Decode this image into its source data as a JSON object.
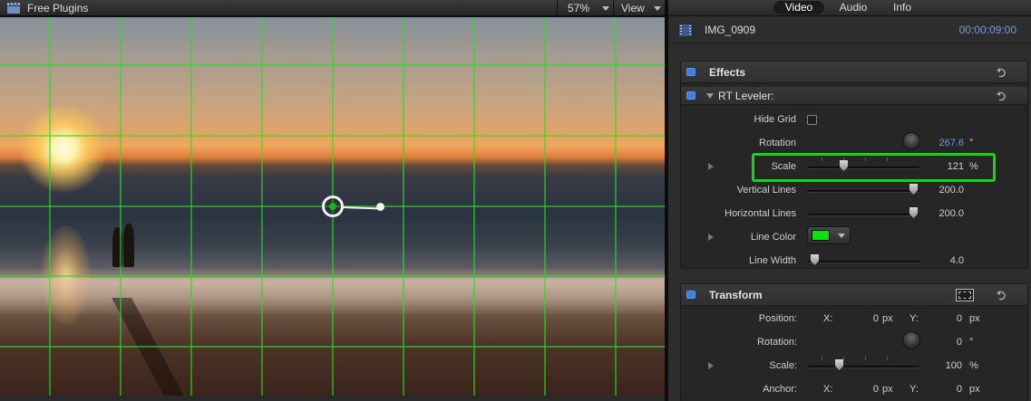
{
  "viewer": {
    "title": "Free Plugins",
    "zoom": "57%",
    "view_menu": "View"
  },
  "inspector": {
    "tabs": [
      {
        "label": "Video",
        "active": true
      },
      {
        "label": "Audio",
        "active": false
      },
      {
        "label": "Info",
        "active": false
      }
    ],
    "clip": {
      "name": "IMG_0909",
      "timecode": "00:00:09:00"
    },
    "effects": {
      "title": "Effects",
      "plugin": {
        "name": "RT Leveler:",
        "params": {
          "hide_grid": {
            "label": "Hide Grid",
            "checked": false
          },
          "rotation": {
            "label": "Rotation",
            "value": "267.6",
            "unit": "°"
          },
          "scale": {
            "label": "Scale",
            "value": "121",
            "unit": "%"
          },
          "vertical_lines": {
            "label": "Vertical Lines",
            "value": "200.0"
          },
          "horizontal_lines": {
            "label": "Horizontal Lines",
            "value": "200.0"
          },
          "line_color": {
            "label": "Line Color",
            "color": "#10e010"
          },
          "line_width": {
            "label": "Line Width",
            "value": "4.0"
          }
        }
      }
    },
    "transform": {
      "title": "Transform",
      "position": {
        "label": "Position:",
        "x_label": "X:",
        "x_value": "0",
        "x_unit": "px",
        "y_label": "Y:",
        "y_value": "0",
        "y_unit": "px"
      },
      "rotation": {
        "label": "Rotation:",
        "value": "0",
        "unit": "°"
      },
      "scale": {
        "label": "Scale:",
        "value": "100",
        "unit": "%"
      },
      "anchor": {
        "label": "Anchor:",
        "x_label": "X:",
        "x_value": "0",
        "x_unit": "px",
        "y_label": "Y:",
        "y_value": "0",
        "y_unit": "px"
      }
    }
  },
  "colors": {
    "accent_blue": "#3e7fe6",
    "timecode_blue": "#6e9ddd",
    "grid_green": "#14d414",
    "highlight_green": "#14d414"
  }
}
